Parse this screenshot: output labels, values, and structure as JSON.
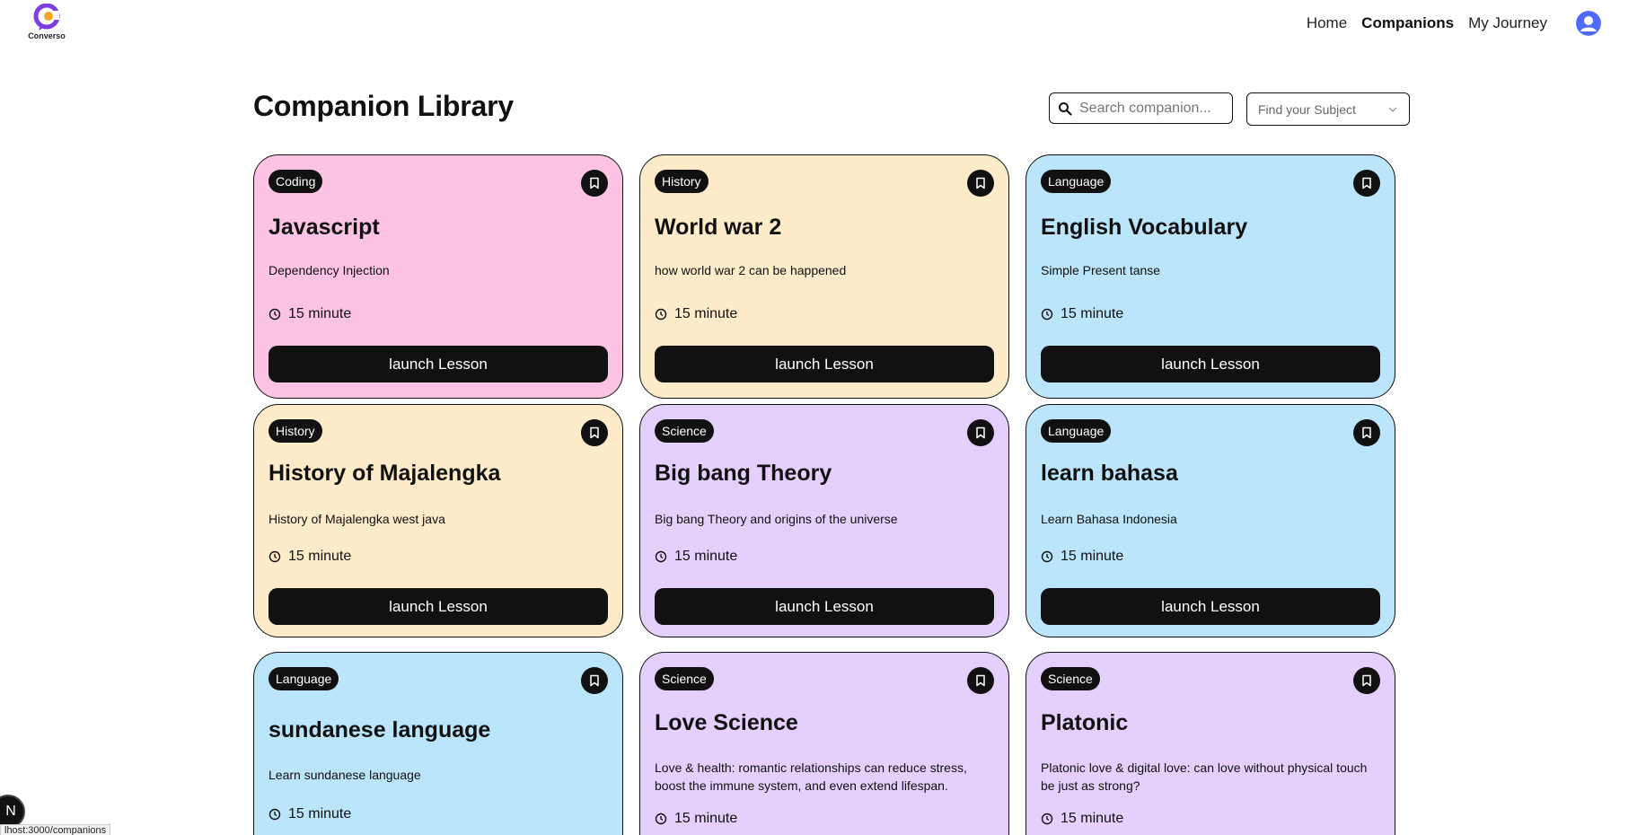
{
  "nav": {
    "logo_text": "Converso",
    "links": [
      "Home",
      "Companions",
      "My Journey"
    ],
    "active": "Companions"
  },
  "header": {
    "title": "Companion Library",
    "search_placeholder": "Search companion...",
    "subject_placeholder": "Find your Subject"
  },
  "cards": [
    {
      "subject": "Coding",
      "title": "Javascript",
      "desc": "Dependency Injection",
      "duration": "15 minute",
      "button": "launch Lesson",
      "color": "#fcc3e4"
    },
    {
      "subject": "History",
      "title": "World war 2",
      "desc": "how world war 2 can be happened",
      "duration": "15 minute",
      "button": "launch Lesson",
      "color": "#fdebc9"
    },
    {
      "subject": "Language",
      "title": "English Vocabulary",
      "desc": "Simple Present tanse",
      "duration": "15 minute",
      "button": "launch Lesson",
      "color": "#bbe5fb"
    },
    {
      "subject": "History",
      "title": "History of Majalengka",
      "desc": "History of Majalengka west java",
      "duration": "15 minute",
      "button": "launch Lesson",
      "color": "#fdebc9"
    },
    {
      "subject": "Science",
      "title": "Big bang Theory",
      "desc": "Big bang Theory and origins of the universe",
      "duration": "15 minute",
      "button": "launch Lesson",
      "color": "#e4cffd"
    },
    {
      "subject": "Language",
      "title": "learn bahasa",
      "desc": "Learn Bahasa Indonesia",
      "duration": "15 minute",
      "button": "launch Lesson",
      "color": "#bbe5fb"
    },
    {
      "subject": "Language",
      "title": "sundanese language",
      "desc": "Learn sundanese language",
      "duration": "15 minute",
      "color": "#bbe5fb"
    },
    {
      "subject": "Science",
      "title": "Love Science",
      "desc": "Love & health: romantic relationships can reduce stress, boost the immune system, and even extend lifespan.",
      "duration": "15 minute",
      "color": "#e4cffd"
    },
    {
      "subject": "Science",
      "title": "Platonic",
      "desc": "Platonic love & digital love: can love without physical touch be just as strong?",
      "duration": "15 minute",
      "color": "#e4cffd"
    }
  ],
  "dev": {
    "badge": "N",
    "status_url": "lhost:3000/companions"
  }
}
